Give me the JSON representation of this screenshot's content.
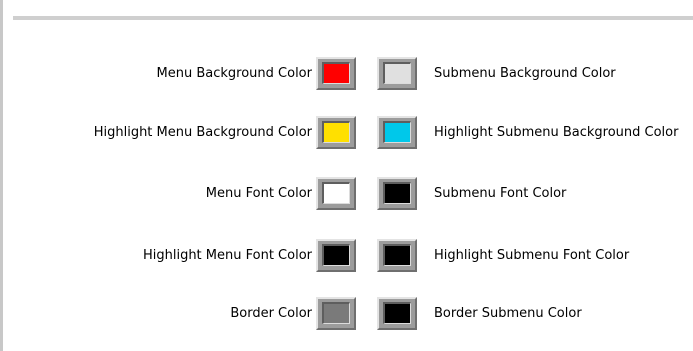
{
  "rows": [
    {
      "left_label": "Menu Background Color",
      "left_color": "#ff0000",
      "right_color": "#e0e0e0",
      "right_label": "Submenu Background Color"
    },
    {
      "left_label": "Highlight Menu Background Color",
      "left_color": "#ffe000",
      "right_color": "#00c8ea",
      "right_label": "Highlight Submenu Background Color"
    },
    {
      "left_label": "Menu Font Color",
      "left_color": "#ffffff",
      "right_color": "#000000",
      "right_label": "Submenu Font Color"
    },
    {
      "left_label": "Highlight Menu Font Color",
      "left_color": "#000000",
      "right_color": "#000000",
      "right_label": "Highlight Submenu Font Color"
    },
    {
      "left_label": "Border Color",
      "left_color": "#7a7a7a",
      "right_color": "#000000",
      "right_label": "Border Submenu Color"
    }
  ]
}
